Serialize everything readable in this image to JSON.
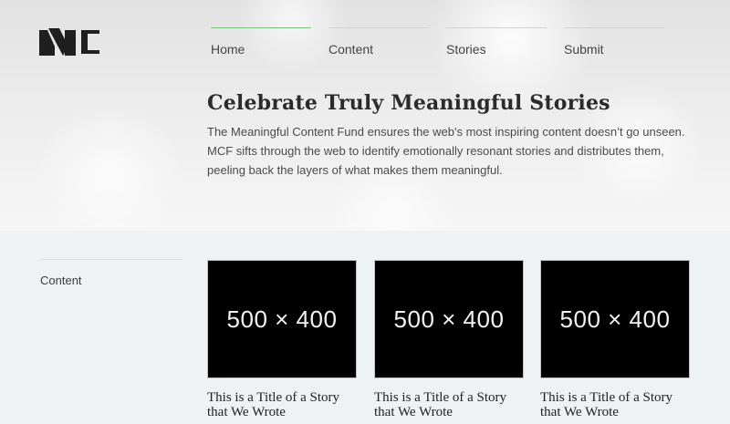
{
  "brand": {
    "logo_text": "MC",
    "logo_icon": "mc-logo-icon"
  },
  "nav": {
    "items": [
      {
        "label": "Home",
        "active": true
      },
      {
        "label": "Content",
        "active": false
      },
      {
        "label": "Stories",
        "active": false
      },
      {
        "label": "Submit",
        "active": false
      }
    ]
  },
  "hero": {
    "title": "Celebrate Truly Meaningful Stories",
    "description": "The Meaningful Content Fund ensures the web's most inspiring content doesn’t go unseen. MCF sifts through the web to identify emotionally resonant stories and distributes them, peeling back the layers of what makes them meaningful."
  },
  "sidebar": {
    "label": "Content"
  },
  "cards": [
    {
      "image_label": "500 × 400",
      "title": "This is a Title of a Story that We Wrote"
    },
    {
      "image_label": "500 × 400",
      "title": "This is a Title of a Story that We Wrote"
    },
    {
      "image_label": "500 × 400",
      "title": "This is a Title of a Story that We Wrote"
    }
  ],
  "colors": {
    "accent": "#7cc07c",
    "card_bg": "#000000",
    "page_bg": "#eef2f2"
  }
}
